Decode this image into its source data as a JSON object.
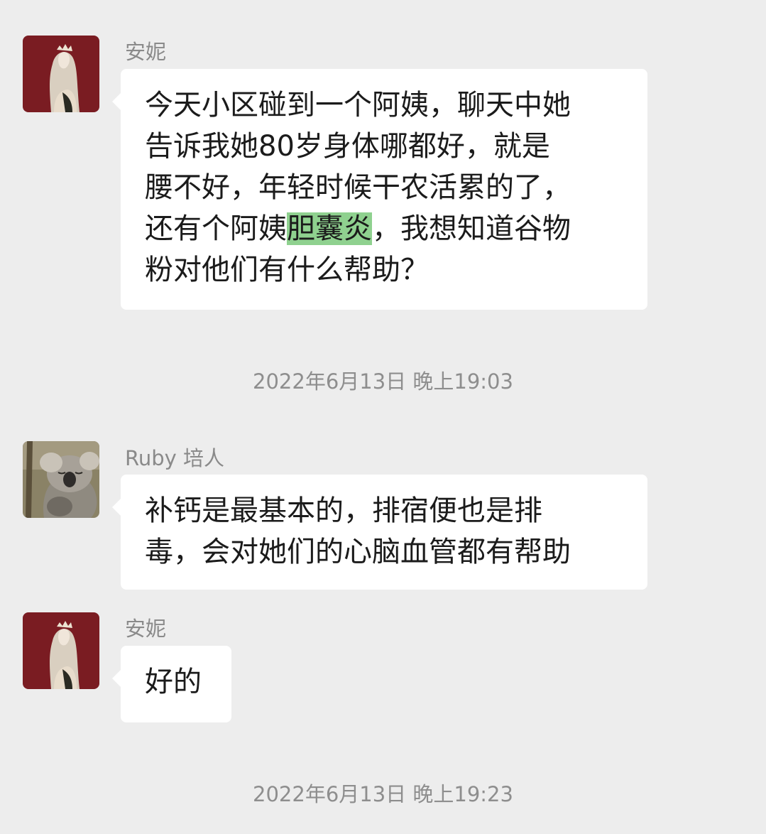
{
  "messages": [
    {
      "sender": "安妮",
      "lines": [
        {
          "text": "今天小区碰到一个阿姨，聊天中她"
        },
        {
          "text": "告诉我她80岁身体哪都好，就是"
        },
        {
          "text": "腰不好，年轻时候干农活累的了，"
        },
        {
          "before": "还有个阿姨",
          "highlight": "胆囊炎",
          "after": "，我想知道谷物"
        },
        {
          "text": "粉对他们有什么帮助？"
        }
      ]
    },
    {
      "sender": "Ruby 培人",
      "lines": [
        {
          "text": "补钙是最基本的，排宿便也是排"
        },
        {
          "text": "毒，会对她们的心脑血管都有帮助"
        }
      ]
    },
    {
      "sender": "安妮",
      "lines": [
        {
          "text": "好的"
        }
      ]
    }
  ],
  "timestamps": [
    "2022年6月13日 晚上19:03",
    "2022年6月13日 晚上19:23"
  ],
  "colors": {
    "background": "#ededed",
    "bubble": "#ffffff",
    "highlight": "#8fd18f",
    "name_text": "#8a8a8a",
    "timestamp_text": "#8e8e8e",
    "annie_avatar_bg": "#7a1c22"
  },
  "icons": [
    "avatar-annie-icon",
    "avatar-koala-icon"
  ]
}
